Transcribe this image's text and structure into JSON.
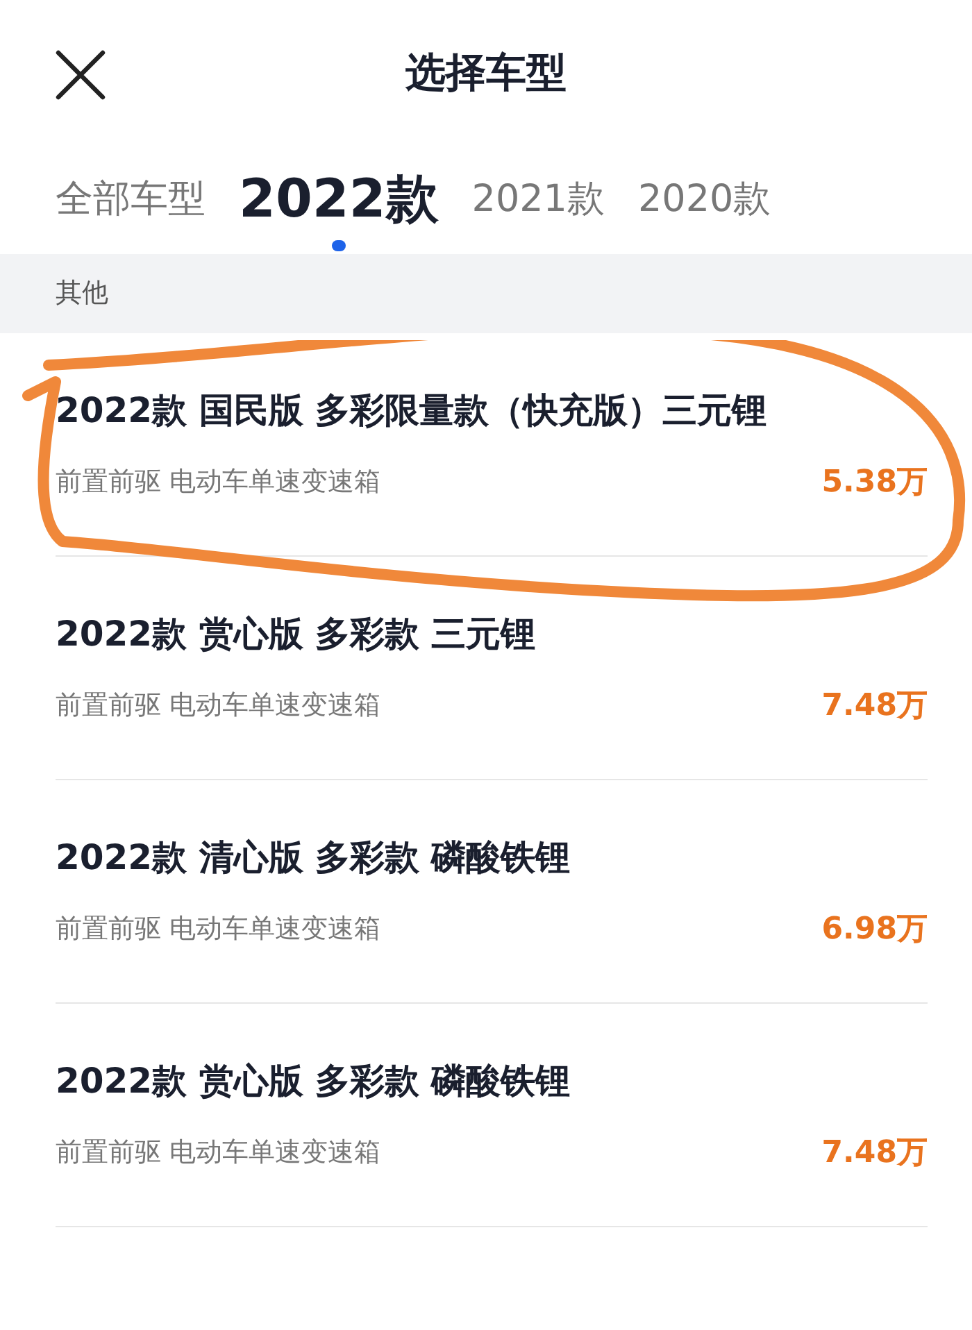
{
  "header": {
    "title": "选择车型"
  },
  "tabs": [
    {
      "label": "全部车型",
      "selected": false
    },
    {
      "label": "2022款",
      "selected": true
    },
    {
      "label": "2021款",
      "selected": false
    },
    {
      "label": "2020款",
      "selected": false
    }
  ],
  "section": {
    "label": "其他"
  },
  "models": [
    {
      "name": "2022款 国民版 多彩限量款（快充版）三元锂",
      "spec": "前置前驱 电动车单速变速箱",
      "price": "5.38万"
    },
    {
      "name": "2022款 赏心版 多彩款 三元锂",
      "spec": "前置前驱 电动车单速变速箱",
      "price": "7.48万"
    },
    {
      "name": "2022款 清心版 多彩款 磷酸铁锂",
      "spec": "前置前驱 电动车单速变速箱",
      "price": "6.98万"
    },
    {
      "name": "2022款 赏心版 多彩款 磷酸铁锂",
      "spec": "前置前驱 电动车单速变速箱",
      "price": "7.48万"
    }
  ]
}
